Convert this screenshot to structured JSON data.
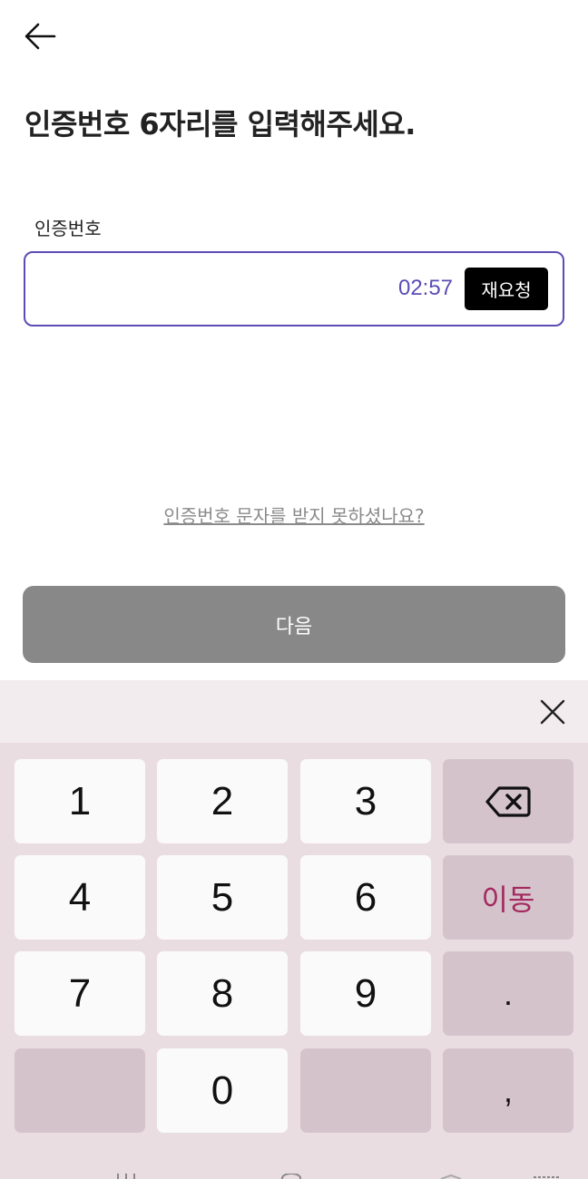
{
  "header": {
    "back_icon": "arrow-left-icon"
  },
  "page": {
    "title": "인증번호 6자리를 입력해주세요."
  },
  "form": {
    "field_label": "인증번호",
    "code_value": "",
    "timer": "02:57",
    "resend_label": "재요청"
  },
  "help": {
    "link_text": "인증번호 문자를 받지 못하셨나요?"
  },
  "footer": {
    "next_label": "다음"
  },
  "keyboard": {
    "close_icon": "close-icon",
    "keys": [
      "1",
      "2",
      "3",
      "backspace",
      "4",
      "5",
      "6",
      "이동",
      "7",
      "8",
      "9",
      ".",
      "",
      "0",
      "",
      ","
    ],
    "backspace_icon": "backspace-icon"
  },
  "colors": {
    "accent": "#5b4db3",
    "button_disabled": "#888888",
    "keyboard_bg": "#eadde2",
    "keyboard_topbar": "#f3ecef",
    "key_light": "#fafafa",
    "key_dark": "#d5c3cc",
    "move_key_text": "#a3295f"
  }
}
